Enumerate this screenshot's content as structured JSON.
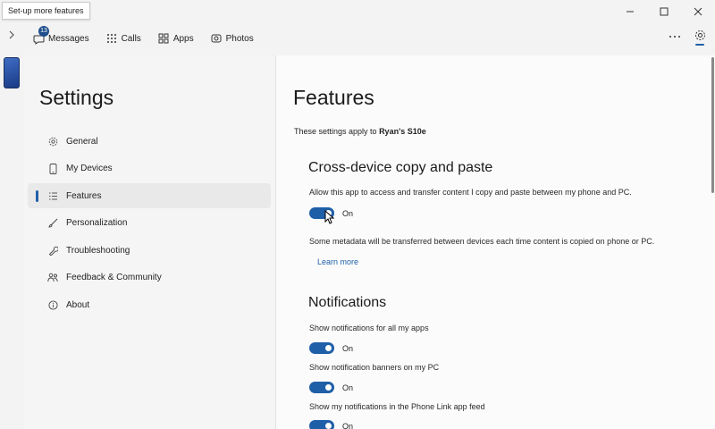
{
  "tooltip": "Set-up more features",
  "topnav": {
    "tabs": [
      {
        "label": "Messages",
        "icon": "message-icon",
        "badge": "13"
      },
      {
        "label": "Calls",
        "icon": "dialpad-icon"
      },
      {
        "label": "Apps",
        "icon": "apps-icon"
      },
      {
        "label": "Photos",
        "icon": "photos-icon"
      }
    ]
  },
  "window": {
    "minimize": "—",
    "maximize": "☐",
    "close": "✕"
  },
  "sidebar": {
    "title": "Settings",
    "items": [
      {
        "label": "General",
        "icon": "gear-icon"
      },
      {
        "label": "My Devices",
        "icon": "phone-icon"
      },
      {
        "label": "Features",
        "icon": "list-icon",
        "active": true
      },
      {
        "label": "Personalization",
        "icon": "brush-icon"
      },
      {
        "label": "Troubleshooting",
        "icon": "wrench-icon"
      },
      {
        "label": "Feedback & Community",
        "icon": "people-icon"
      },
      {
        "label": "About",
        "icon": "info-icon"
      }
    ]
  },
  "main": {
    "title": "Features",
    "applies_prefix": "These settings apply to ",
    "device_name": "Ryan's S10e",
    "copy_paste": {
      "heading": "Cross-device copy and paste",
      "description": "Allow this app to access and transfer content I copy and paste between my phone and PC.",
      "toggle_label": "On",
      "note": "Some metadata will be transferred between devices each time content is copied on phone or PC.",
      "learn_more": "Learn more"
    },
    "notifications": {
      "heading": "Notifications",
      "settings": [
        {
          "label": "Show notifications for all my apps",
          "state": "On"
        },
        {
          "label": "Show notification banners on my PC",
          "state": "On"
        },
        {
          "label": "Show my notifications in the Phone Link app feed",
          "state": "On"
        }
      ]
    }
  },
  "colors": {
    "accent": "#1f5fa8",
    "badge": "#1f4e8c"
  }
}
